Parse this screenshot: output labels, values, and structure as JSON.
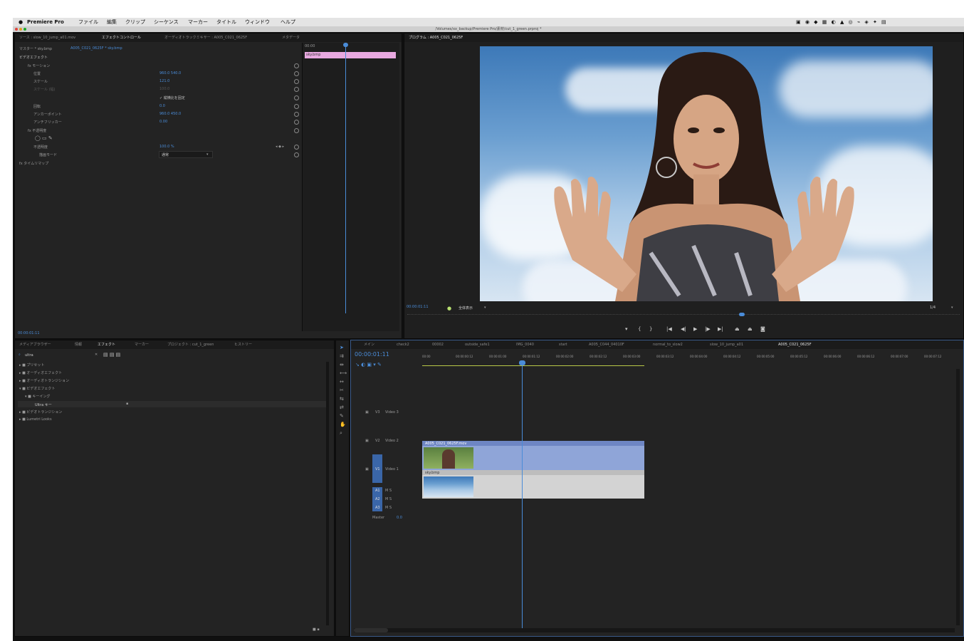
{
  "menubar": {
    "app": "Premiere Pro",
    "items": [
      "ファイル",
      "編集",
      "クリップ",
      "シーケンス",
      "マーカー",
      "タイトル",
      "ウィンドウ",
      "ヘルプ"
    ],
    "path": "/Volumes/xx_backup/Premiere Pro/素材/cut_1_green.prproj *"
  },
  "effect_controls": {
    "tabs": [
      "ソース : slow_10_jump_a01.mov",
      "エフェクトコントロール",
      "オーディオトラックミキサー : A005_C021_0625F",
      "メタデータ"
    ],
    "master": "マスター * sky.bmp",
    "clip": "A005_C021_0625F * sky.bmp",
    "ruler": "00:00",
    "clip_bar_label": "sky.bmp",
    "section": "ビデオエフェクト",
    "params": [
      {
        "label": "fx  モーション",
        "value": ""
      },
      {
        "label": "位置",
        "value": "960.0   540.0"
      },
      {
        "label": "スケール",
        "value": "121.0"
      },
      {
        "label": "スケール (幅)",
        "value": "100.0"
      },
      {
        "label": "",
        "value": "✓ 縦横比を固定"
      },
      {
        "label": "回転",
        "value": "0.0"
      },
      {
        "label": "アンカーポイント",
        "value": "960.0   450.0"
      },
      {
        "label": "アンチフリッカー",
        "value": "0.00"
      },
      {
        "label": "fx  不透明度",
        "value": ""
      },
      {
        "label": "",
        "value": ""
      },
      {
        "label": "不透明度",
        "value": "100.0 %"
      },
      {
        "label": "描画モード",
        "value": "通常"
      },
      {
        "label": "fx  タイムリマップ",
        "value": ""
      }
    ],
    "timecode": "00:00:01:11"
  },
  "program": {
    "tab": "プログラム : A005_C021_0625F",
    "timecode": "00:00:01:11",
    "fit": "全体表示",
    "zoom": "1/4",
    "playhead_fraction": 0.6
  },
  "effects_panel": {
    "tabs": [
      "メディアブラウザー",
      "情報",
      "エフェクト",
      "マーカー",
      "プロジェクト : cut_1_green",
      "ヒストリー"
    ],
    "search": "ultra",
    "tree": [
      "プリセット",
      "オーディオエフェクト",
      "オーディオトランジション",
      "ビデオエフェクト",
      "キーイング",
      "Ultra キー",
      "ビデオトランジション",
      "Lumetri Looks"
    ]
  },
  "timeline": {
    "tabs": [
      "メイン",
      "check2",
      "00002",
      "outside_safe1",
      "IMG_0040",
      "start",
      "A005_C044_04010F",
      "normal_to_slow2",
      "slow_10_jump_a01",
      "A005_C021_0625F"
    ],
    "timecode": "00:00:01:11",
    "ruler": [
      "00:00",
      "00:00:00:12",
      "00:00:01:00",
      "00:00:01:12",
      "00:00:02:00",
      "00:00:02:12",
      "00:00:03:00",
      "00:00:03:12",
      "00:00:04:00",
      "00:00:04:12",
      "00:00:05:00",
      "00:00:05:12",
      "00:00:06:00",
      "00:00:06:12",
      "00:00:07:00",
      "00:00:07:12"
    ],
    "tracks": [
      {
        "id": "V3",
        "name": "Video 3"
      },
      {
        "id": "V2",
        "name": "Video 2"
      },
      {
        "id": "V1",
        "name": "Video 1"
      },
      {
        "id": "A1",
        "name": "M S"
      },
      {
        "id": "A2",
        "name": "M S"
      },
      {
        "id": "A3",
        "name": "M S"
      }
    ],
    "master_label": "Master",
    "master_value": "0.0",
    "clips": [
      {
        "name": "A005_C021_0625F.mov",
        "track": "V2"
      },
      {
        "name": "sky.bmp",
        "track": "V1"
      }
    ]
  },
  "colors": {
    "panel": "#232323",
    "accent_blue": "#4a8cd8",
    "clip_v2": "#8fa5d8",
    "clip_v1": "#d3d3d3",
    "clip_label_pink": "#e8a8e0"
  }
}
